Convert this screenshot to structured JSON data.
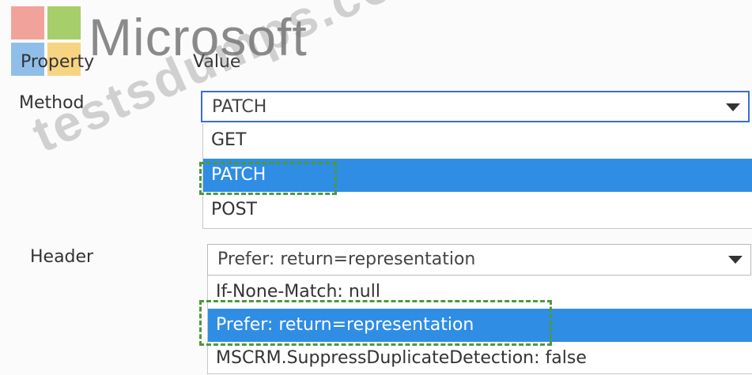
{
  "logo": {
    "text": "Microsoft"
  },
  "columns": {
    "property": "Property",
    "value": "Value"
  },
  "method": {
    "label": "Method",
    "selected": "PATCH",
    "options": [
      "GET",
      "PATCH",
      "POST"
    ],
    "highlighted_option": "PATCH"
  },
  "header": {
    "label": "Header",
    "selected": "Prefer: return=representation",
    "options": [
      "If-None-Match: null",
      "Prefer: return=representation",
      "MSCRM.SuppressDuplicateDetection: false"
    ],
    "highlighted_option": "Prefer: return=representation"
  },
  "watermark": {
    "text": "testsdumps.com"
  },
  "colors": {
    "highlight": "#2f8de4",
    "focus_border": "#3b6fd0",
    "dash": "#4b9a3c"
  }
}
